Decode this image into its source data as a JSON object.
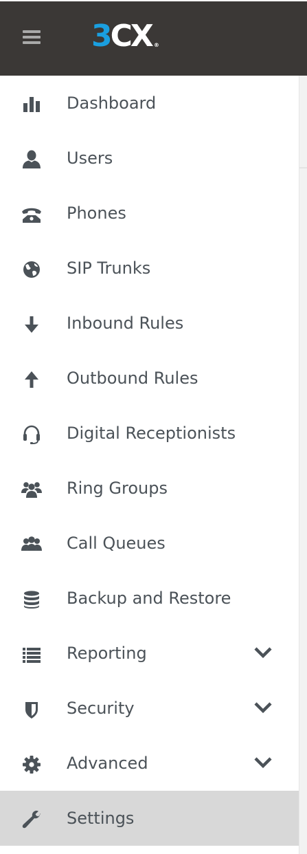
{
  "app": {
    "logo_text_3": "3",
    "logo_text_cx": "CX",
    "logo_reg": "®"
  },
  "colors": {
    "header_bg": "#3b3836",
    "logo_blue": "#1a9fe0",
    "text": "#4b5258",
    "icon": "#4b5258",
    "active_bg": "#d8d8d8"
  },
  "sidebar": {
    "items": [
      {
        "label": "Dashboard",
        "icon": "bar-chart-icon",
        "has_submenu": false,
        "active": false
      },
      {
        "label": "Users",
        "icon": "user-icon",
        "has_submenu": false,
        "active": false
      },
      {
        "label": "Phones",
        "icon": "phone-icon",
        "has_submenu": false,
        "active": false
      },
      {
        "label": "SIP Trunks",
        "icon": "globe-icon",
        "has_submenu": false,
        "active": false
      },
      {
        "label": "Inbound Rules",
        "icon": "arrow-down-icon",
        "has_submenu": false,
        "active": false
      },
      {
        "label": "Outbound Rules",
        "icon": "arrow-up-icon",
        "has_submenu": false,
        "active": false
      },
      {
        "label": "Digital Receptionists",
        "icon": "headset-icon",
        "has_submenu": false,
        "active": false
      },
      {
        "label": "Ring Groups",
        "icon": "ring-group-icon",
        "has_submenu": false,
        "active": false
      },
      {
        "label": "Call Queues",
        "icon": "call-queue-icon",
        "has_submenu": false,
        "active": false
      },
      {
        "label": "Backup and Restore",
        "icon": "database-icon",
        "has_submenu": false,
        "active": false
      },
      {
        "label": "Reporting",
        "icon": "list-icon",
        "has_submenu": true,
        "active": false
      },
      {
        "label": "Security",
        "icon": "shield-icon",
        "has_submenu": true,
        "active": false
      },
      {
        "label": "Advanced",
        "icon": "gear-icon",
        "has_submenu": true,
        "active": false
      },
      {
        "label": "Settings",
        "icon": "wrench-icon",
        "has_submenu": false,
        "active": true
      }
    ]
  }
}
